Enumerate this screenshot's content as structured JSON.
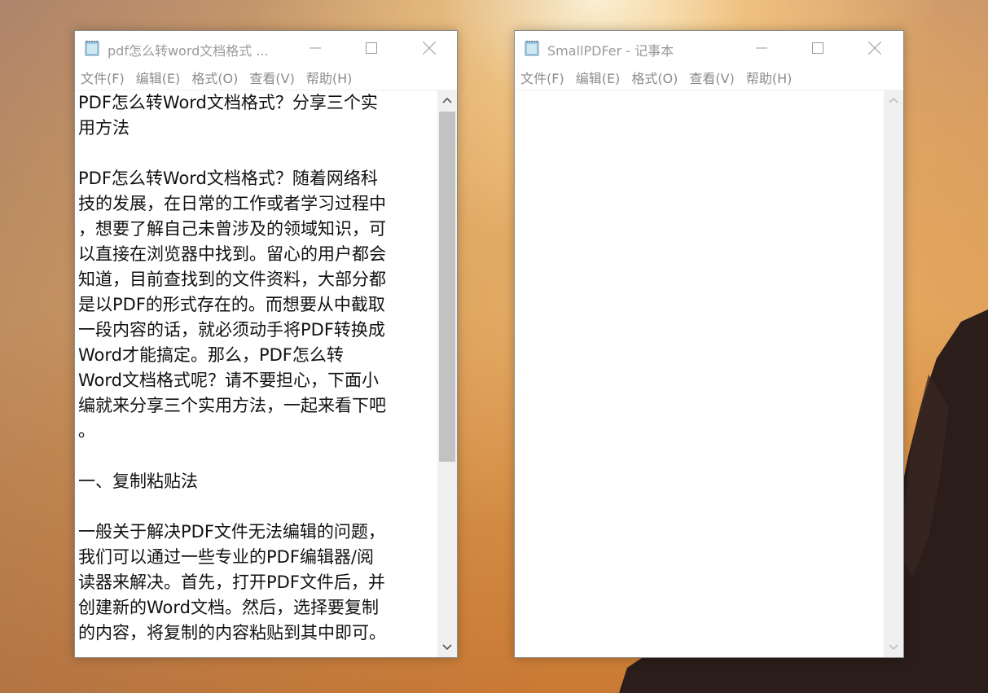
{
  "desktop": {
    "wallpaper": "sunset-silhouette"
  },
  "window_left": {
    "title": "pdf怎么转word文档格式 ...",
    "menu": [
      "文件(F)",
      "编辑(E)",
      "格式(O)",
      "查看(V)",
      "帮助(H)"
    ],
    "text": "PDF怎么转Word文档格式？分享三个实\n用方法\n\nPDF怎么转Word文档格式？随着网络科\n技的发展，在日常的工作或者学习过程中\n，想要了解自己未曾涉及的领域知识，可\n以直接在浏览器中找到。留心的用户都会\n知道，目前查找到的文件资料，大部分都\n是以PDF的形式存在的。而想要从中截取\n一段内容的话，就必须动手将PDF转换成\nWord才能搞定。那么，PDF怎么转\nWord文档格式呢？请不要担心，下面小\n编就来分享三个实用方法，一起来看下吧\n。\n\n一、复制粘贴法\n\n一般关于解决PDF文件无法编辑的问题，\n我们可以通过一些专业的PDF编辑器/阅\n读器来解决。首先，打开PDF文件后，并\n创建新的Word文档。然后，选择要复制\n的内容，将复制的内容粘贴到其中即可。"
  },
  "window_right": {
    "title": "SmallPDFer - 记事本",
    "menu": [
      "文件(F)",
      "编辑(E)",
      "格式(O)",
      "查看(V)",
      "帮助(H)"
    ],
    "text": ""
  },
  "icons": {
    "minimize": "minimize-icon",
    "maximize": "maximize-icon",
    "close": "close-icon",
    "notepad": "notepad-icon",
    "scroll_up": "scroll-up-arrow-icon",
    "scroll_down": "scroll-down-arrow-icon"
  },
  "colors": {
    "title_text": "#9a9a9a",
    "menu_text": "#8c8c8c",
    "scrollbar_track": "#f0f0f0",
    "scrollbar_thumb": "#c2c2c2"
  }
}
